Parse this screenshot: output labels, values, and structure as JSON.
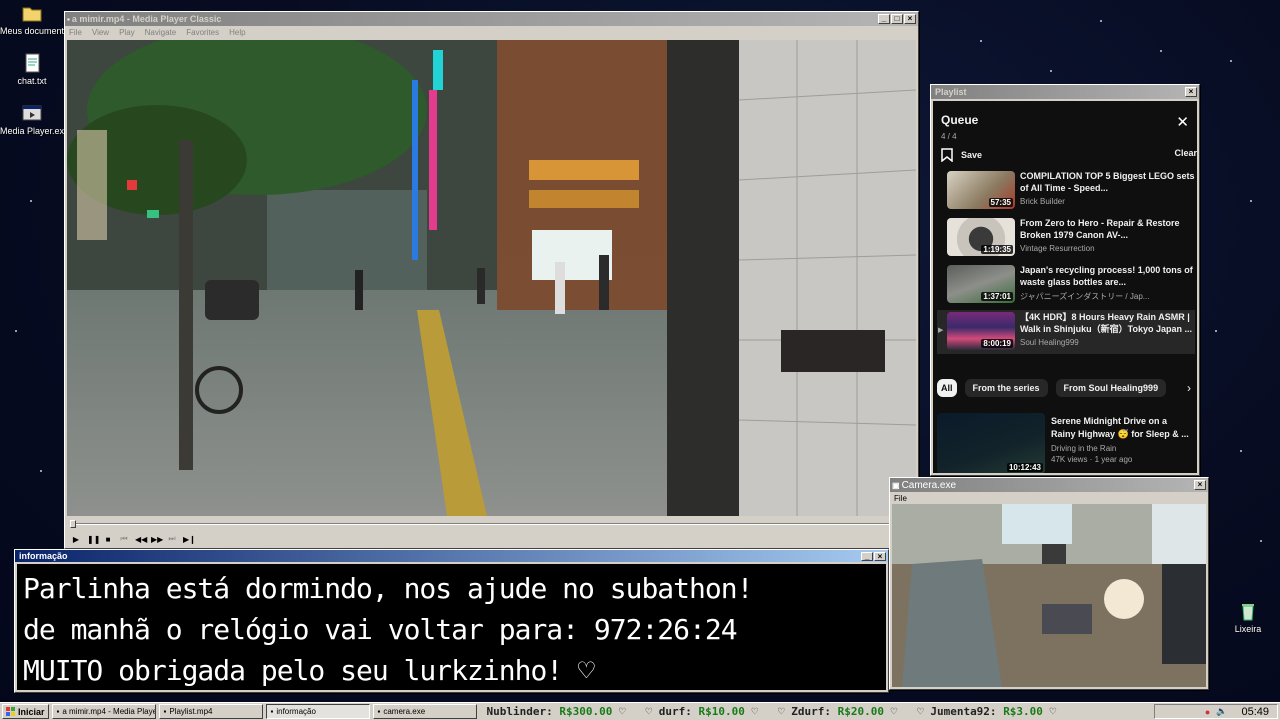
{
  "desktop": {
    "icons": [
      {
        "label": "Meus documentos",
        "icon": "folder-icon"
      },
      {
        "label": "chat.txt",
        "icon": "text-file-icon"
      },
      {
        "label": "Media Player.exe",
        "icon": "exe-icon"
      },
      {
        "label": "Lixeira",
        "icon": "recycle-bin-icon"
      }
    ]
  },
  "mpc": {
    "title": "a mimir.mp4 - Media Player Classic",
    "menu": [
      "File",
      "View",
      "Play",
      "Navigate",
      "Favorites",
      "Help"
    ]
  },
  "playlist": {
    "title": "Playlist",
    "queue_title": "Queue",
    "queue_count": "4 / 4",
    "save_label": "Save",
    "clear_label": "Clear",
    "items": [
      {
        "title": "COMPILATION TOP 5 Biggest LEGO sets of All Time - Speed...",
        "channel": "Brick Builder",
        "duration": "57:35"
      },
      {
        "title": "From Zero to Hero - Repair & Restore Broken 1979 Canon AV-...",
        "channel": "Vintage Resurrection",
        "duration": "1:19:35"
      },
      {
        "title": "Japan's recycling process! 1,000 tons of waste glass bottles are...",
        "channel": "ジャパニーズインダストリー / Jap...",
        "duration": "1:37:01"
      },
      {
        "title": "【4K HDR】8 Hours Heavy Rain ASMR | Walk in Shinjuku（新宿）Tokyo Japan ...",
        "channel": "Soul Healing999",
        "duration": "8:00:19"
      }
    ],
    "chips": [
      "All",
      "From the series",
      "From Soul Healing999"
    ],
    "recommended": {
      "title": "Serene Midnight Drive on a Rainy Highway 😴 for Sleep & ...",
      "channel": "Driving in the Rain",
      "meta": "47K views · 1 year ago",
      "duration": "10:12:43"
    }
  },
  "info": {
    "title": "informação",
    "lines": [
      "Parlinha está dormindo, nos ajude no subathon!",
      "de manhã o relógio vai voltar para:  972:26:24",
      "MUITO obrigada pelo seu lurkzinho! ♡"
    ]
  },
  "camera": {
    "title": "Camera.exe",
    "menu_file": "File"
  },
  "taskbar": {
    "start_label": "Iniciar",
    "tasks": [
      "a mimir.mp4 - Media Playe...",
      "Playlist.mp4",
      "informação",
      "camera.exe"
    ],
    "ticker": [
      {
        "name": "Nublinder:",
        "amount": "R$300.00"
      },
      {
        "name": "durf:",
        "amount": "R$10.00"
      },
      {
        "name": "Zdurf:",
        "amount": "R$20.00"
      },
      {
        "name": "Jumenta92:",
        "amount": "R$3.00"
      }
    ],
    "clock": "05:49"
  },
  "colors": {
    "accent": "#0a246a",
    "youtube_bg": "#0f0f0f",
    "ticker_amount": "#1a7a1a"
  }
}
